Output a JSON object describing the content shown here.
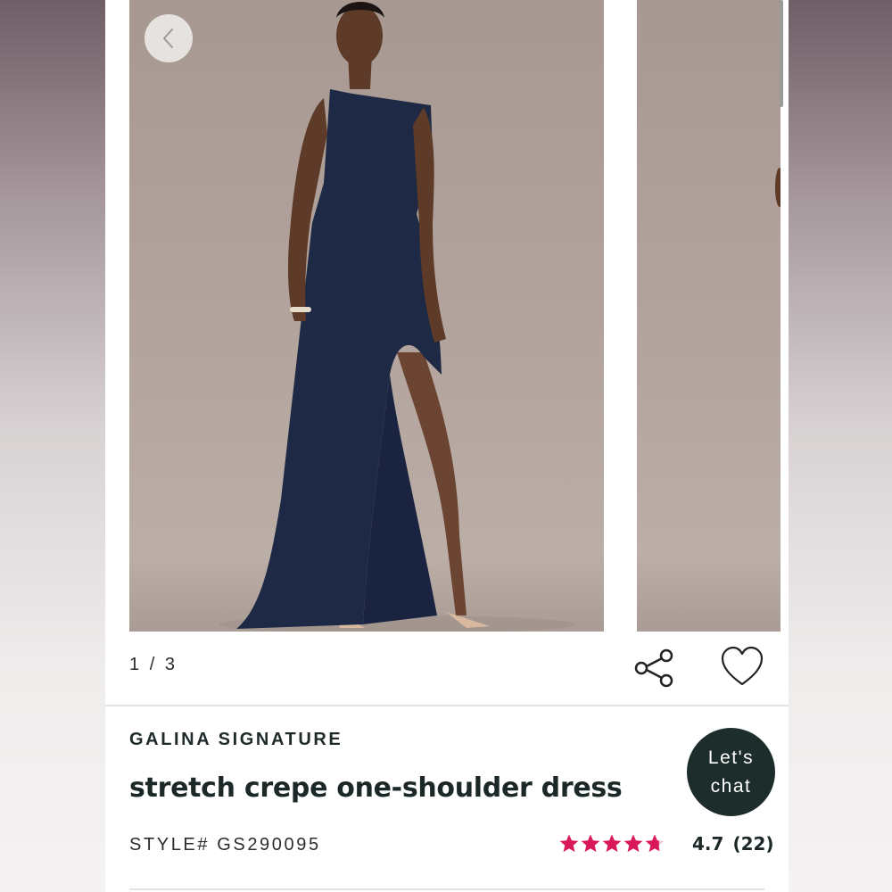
{
  "gallery": {
    "current_page": "1",
    "separator": "/",
    "total_pages": "3",
    "back_icon": "chevron-left-icon"
  },
  "actions": {
    "share_icon": "share-icon",
    "favorite_icon": "heart-icon"
  },
  "product": {
    "brand": "GALINA SIGNATURE",
    "name": "stretch crepe one-shoulder dress",
    "style_label": "STYLE# GS290095",
    "rating_value": "4.7",
    "rating_count": "(22)",
    "rating_stars": 4.7,
    "rating_max": 5
  },
  "chat": {
    "line1": "Let's",
    "line2": "chat"
  },
  "colors": {
    "star": "#d9195a",
    "chat_bg": "#1d2d2b",
    "dress": "#1e2a45"
  }
}
